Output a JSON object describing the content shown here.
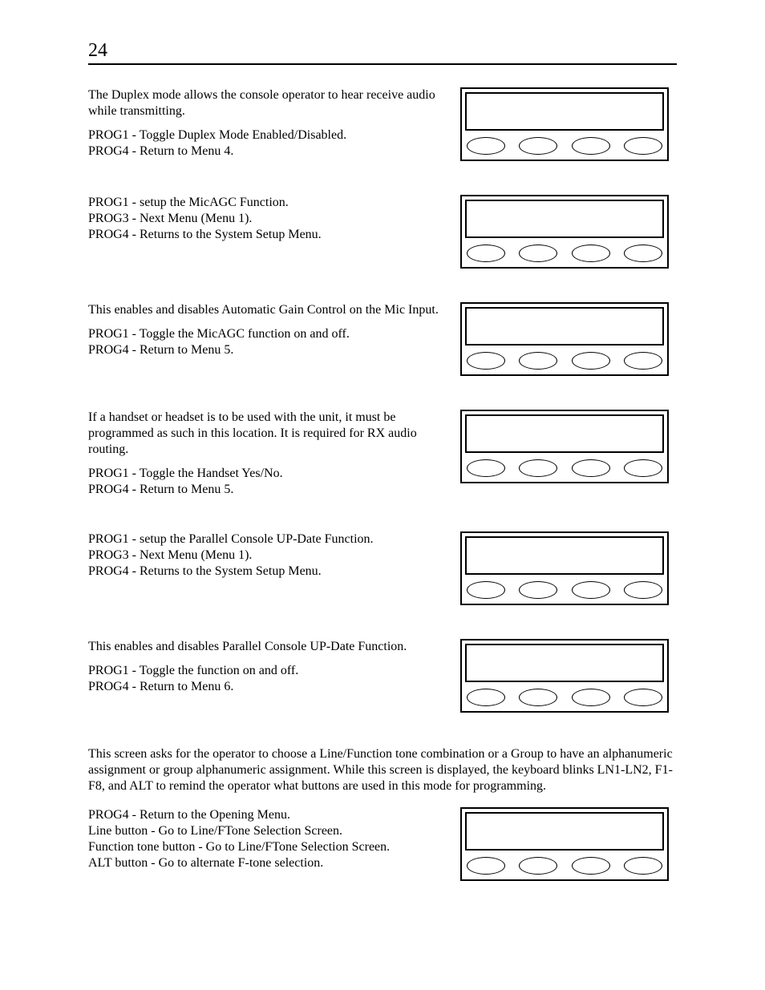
{
  "page_number": "24",
  "sections": [
    {
      "intro": "The Duplex mode allows the console operator to hear receive audio while transmitting.",
      "lines": [
        "PROG1 - Toggle Duplex Mode Enabled/Disabled.",
        "PROG4 - Return to Menu 4."
      ]
    },
    {
      "intro": "",
      "lines": [
        "PROG1 - setup the MicAGC Function.",
        "PROG3 - Next Menu (Menu 1).",
        "PROG4 - Returns to the System Setup Menu."
      ]
    },
    {
      "intro": "This enables and disables Automatic Gain Control on the Mic Input.",
      "lines": [
        "PROG1 - Toggle the MicAGC function on and off.",
        "PROG4 - Return to Menu 5."
      ]
    },
    {
      "intro": "If a handset or headset is to be used with the unit, it must be programmed as such in this location.  It is required for RX audio routing.",
      "lines": [
        "PROG1 - Toggle the Handset Yes/No.",
        "PROG4 - Return to Menu 5."
      ]
    },
    {
      "intro": "",
      "lines": [
        "PROG1 - setup the Parallel Console UP-Date Function.",
        "PROG3 - Next Menu (Menu 1).",
        "PROG4 - Returns to the System Setup Menu."
      ]
    },
    {
      "intro": "This enables and disables Parallel Console UP-Date Function.",
      "lines": [
        "PROG1 - Toggle the function on and off.",
        "PROG4 - Return to Menu 6."
      ]
    }
  ],
  "big_paragraph": "This screen asks for the operator to choose a Line/Function tone combination or a Group to have an alphanumeric assignment or group alphanumeric assignment.  While this screen is displayed, the keyboard blinks LN1-LN2, F1-F8, and ALT to remind the operator what buttons are used in this mode for programming.",
  "last_section": {
    "lines": [
      "PROG4 - Return to the Opening Menu.",
      "Line button - Go to Line/FTone Selection Screen.",
      "Function tone button - Go to Line/FTone Selection Screen.",
      "ALT button - Go to alternate F-tone selection."
    ]
  }
}
